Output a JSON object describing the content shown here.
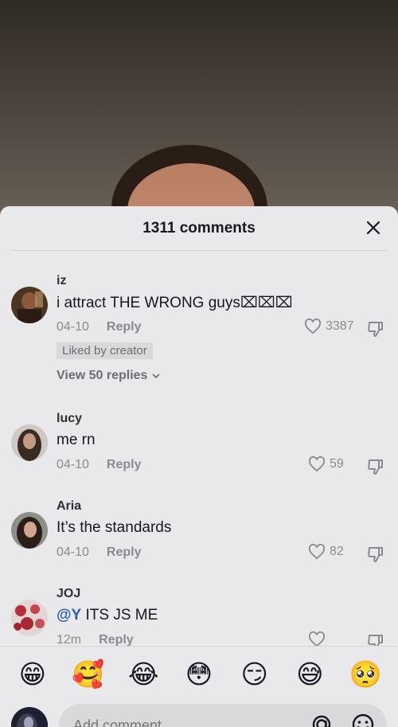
{
  "sheet": {
    "title": "1311 comments"
  },
  "comments": [
    {
      "username": "iz",
      "text": "i attract THE WRONG guys⌧⌧⌧",
      "date": "04-10",
      "reply_label": "Reply",
      "likes": "3387",
      "badge": "Liked by creator",
      "view_replies": "View 50 replies"
    },
    {
      "username": "lucy",
      "text": "me rn",
      "date": "04-10",
      "reply_label": "Reply",
      "likes": "59"
    },
    {
      "username": "Aria",
      "text": "It’s the standards",
      "date": "04-10",
      "reply_label": "Reply",
      "likes": "82"
    },
    {
      "username": "JOJ",
      "mention": "@Y",
      "text": " ITS JS ME",
      "date": "12m",
      "reply_label": "Reply",
      "likes": ""
    }
  ],
  "emoji_bar": {
    "emojis": [
      "😁",
      "🥰",
      "😂",
      "😳",
      "😏",
      "😅",
      "🥺"
    ]
  },
  "composer": {
    "placeholder": "Add comment..."
  },
  "colors": {
    "sheet_bg": "#e9e9eb",
    "mention": "#2b5db0",
    "meta_text": "#8a8b91"
  }
}
